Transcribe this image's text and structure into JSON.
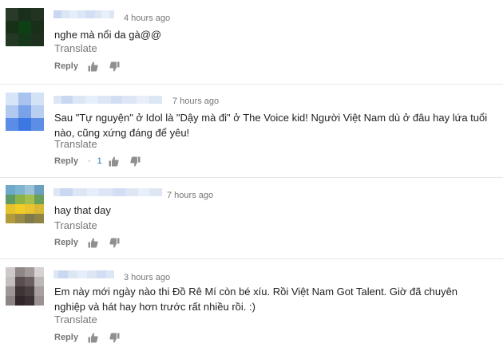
{
  "comments": [
    {
      "time": "4 hours ago",
      "text": "nghe mà nổi da gà@@",
      "translate": "Translate",
      "reply": "Reply",
      "like_count": ""
    },
    {
      "time": "7 hours ago",
      "text": "Sau \"Tự nguyện\" ở Idol là \"Dậy mà đi\" ở The Voice kid! Người Việt Nam dù ở đâu hay lứa tuổi nào, cũng xứng đáng để yêu!",
      "translate": "Translate",
      "reply": "Reply",
      "like_count": "1"
    },
    {
      "time": "7 hours ago",
      "text": "hay that day",
      "translate": "Translate",
      "reply": "Reply",
      "like_count": ""
    },
    {
      "time": "3 hours ago",
      "text": "Em này mới ngày nào thi Đồ Rê Mí còn bé xíu. Rồi Việt Nam Got Talent. Giờ đã chuyên nghiệp và hát hay hơn trước rất nhiều rồi. :)",
      "translate": "Translate",
      "reply": "Reply",
      "like_count": ""
    }
  ],
  "icons": {
    "like": "thumbs-up-icon",
    "dislike": "thumbs-down-icon"
  },
  "colors": {
    "meta_text": "#767676",
    "body_text": "#222222",
    "link_blue": "#167ac6",
    "divider": "#e8e8e8"
  }
}
